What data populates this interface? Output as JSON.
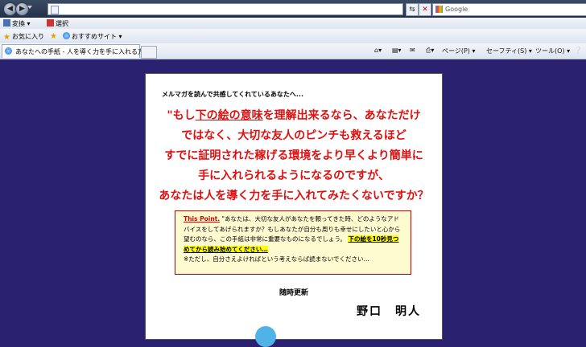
{
  "browser": {
    "address_value": "",
    "search_placeholder": "Google",
    "toolbar2": {
      "convert_label": "変換",
      "select_label": "選択"
    },
    "favorites": {
      "favorites_label": "お気に入り",
      "suggested_label": "おすすめサイト"
    },
    "tab_title": "あなたへの手紙 - 人を導く力を手に入れる方法",
    "commands": {
      "page": "ページ(P)",
      "safety": "セーフティ(S)",
      "tools": "ツール(O)"
    }
  },
  "page": {
    "intro": "メルマガを読んで共感してくれているあなたへ...",
    "headline": {
      "l1_a": "\"もし",
      "l1_u": "下の絵の意味",
      "l1_b": "を理解出来るなら、あなただけ",
      "l2": "ではなく、大切な友人のピンチも救えるほど",
      "l3": "すでに証明された稼げる環境をより早くより簡単に",
      "l4": "手に入れられるようになるのですが、",
      "l5": "あなたは人を導く力を手に入れてみたくないですか？"
    },
    "point": {
      "label": "This Point.",
      "text": "\"あなたは、大切な友人があなたを頼ってきた時、どのようなアドバイスをしてあげられますか？もしあなたが自分も周りも幸せにしたいと心から望むのなら、この手紙は非常に重要なものになるでしょう。",
      "highlight": "下の絵を10秒見つめてから読み始めてください…",
      "note": "※ただし、自分さえよければという考えならば読まないでください…"
    },
    "updated": "随時更新",
    "author": "野口　明人"
  }
}
